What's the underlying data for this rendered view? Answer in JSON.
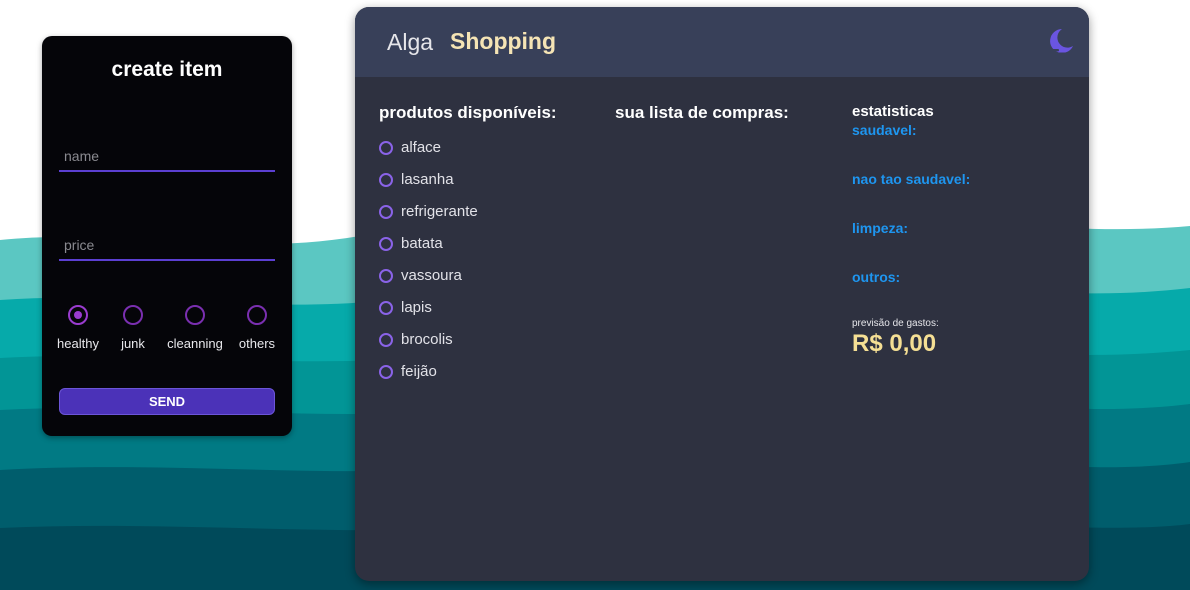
{
  "create_form": {
    "title": "create item",
    "name_placeholder": "name",
    "price_placeholder": "price",
    "categories": [
      {
        "label": "healthy",
        "checked": true
      },
      {
        "label": "junk",
        "checked": false
      },
      {
        "label": "cleanning",
        "checked": false
      },
      {
        "label": "others",
        "checked": false
      }
    ],
    "send_label": "SEND"
  },
  "header": {
    "brand_light": "Alga",
    "brand_bold": "Shopping",
    "theme_icon": "moon-icon"
  },
  "columns": {
    "products_title": "produtos disponíveis:",
    "list_title": "sua lista de compras:"
  },
  "products": [
    "alface",
    "lasanha",
    "refrigerante",
    "batata",
    "vassoura",
    "lapis",
    "brocolis",
    "feijão"
  ],
  "stats": {
    "title": "estatisticas",
    "healthy": "saudavel:",
    "junk": "nao tao saudavel:",
    "cleaning": "limpeza:",
    "others": "outros:",
    "forecast_label": "previsão de gastos:",
    "forecast_value": "R$ 0,00"
  },
  "colors": {
    "accent": "#4b32b8",
    "brand": "#f5e4b5",
    "stat_label": "#1e96f0",
    "forecast": "#f5df94",
    "panel_bg": "#2e3140",
    "header_bg": "#384059"
  }
}
